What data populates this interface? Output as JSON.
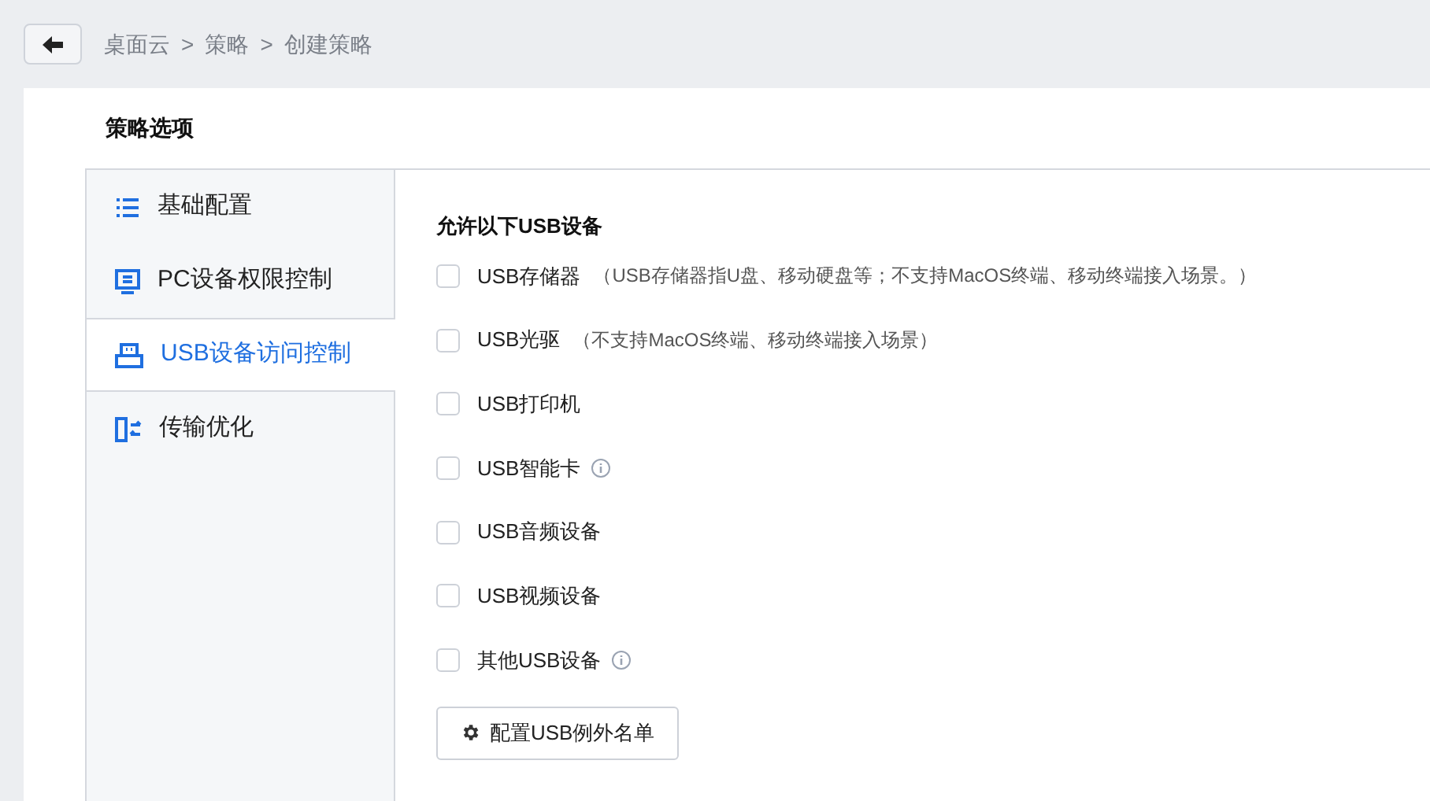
{
  "breadcrumb": [
    {
      "label": "桌面云"
    },
    {
      "separator": ">",
      "label": "策略"
    },
    {
      "separator": ">",
      "label": "创建策略"
    }
  ],
  "section_title": "策略选项",
  "sidebar": {
    "items": [
      {
        "label": "基础配置",
        "kind": "list",
        "selected": false
      },
      {
        "label": "PC设备权限控制",
        "kind": "monitor",
        "selected": false
      },
      {
        "label": "USB设备访问控制",
        "kind": "usb",
        "selected": true
      },
      {
        "label": "传输优化",
        "kind": "transfer",
        "selected": false
      }
    ]
  },
  "group_title": "允许以下USB设备",
  "devices": [
    {
      "label": "USB存储器",
      "note": "（USB存储器指U盘、移动硬盘等；不支持MacOS终端、移动终端接入场景。）",
      "info": false,
      "checked": false
    },
    {
      "label": "USB光驱",
      "note": "（不支持MacOS终端、移动终端接入场景）",
      "info": false,
      "checked": false
    },
    {
      "label": "USB打印机",
      "info": false,
      "checked": false
    },
    {
      "label": "USB智能卡",
      "info": true,
      "checked": false
    },
    {
      "label": "USB音频设备",
      "info": false,
      "checked": false
    },
    {
      "label": "USB视频设备",
      "info": false,
      "checked": false
    },
    {
      "label": "其他USB设备",
      "info": true,
      "checked": false
    }
  ],
  "exception_button": "配置USB例外名单"
}
